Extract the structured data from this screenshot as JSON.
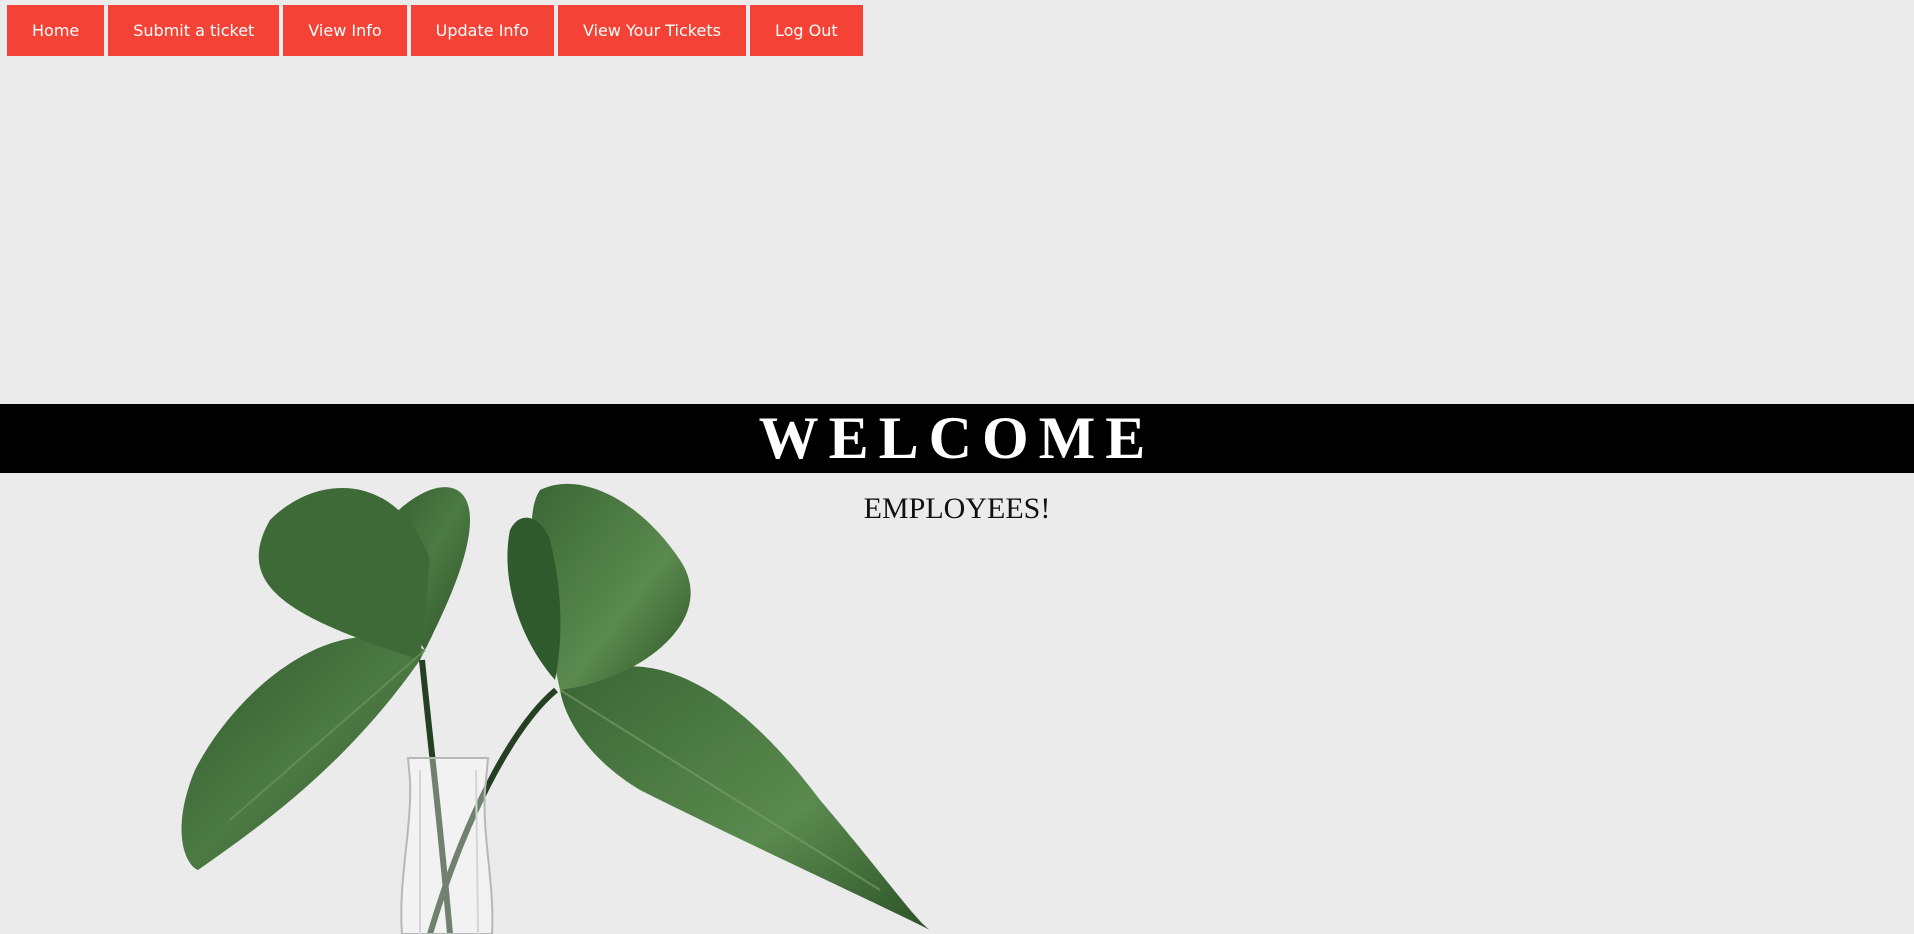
{
  "nav": {
    "items": [
      {
        "label": "Home"
      },
      {
        "label": "Submit a ticket"
      },
      {
        "label": "View Info"
      },
      {
        "label": "Update Info"
      },
      {
        "label": "View Your Tickets"
      },
      {
        "label": "Log Out"
      }
    ],
    "color": "#f44336"
  },
  "banner": {
    "title": "WELCOME"
  },
  "subtitle": "EMPLOYEES!",
  "colors": {
    "background": "#ebebeb",
    "banner": "#000000",
    "leaf": "#3f6b3a"
  }
}
